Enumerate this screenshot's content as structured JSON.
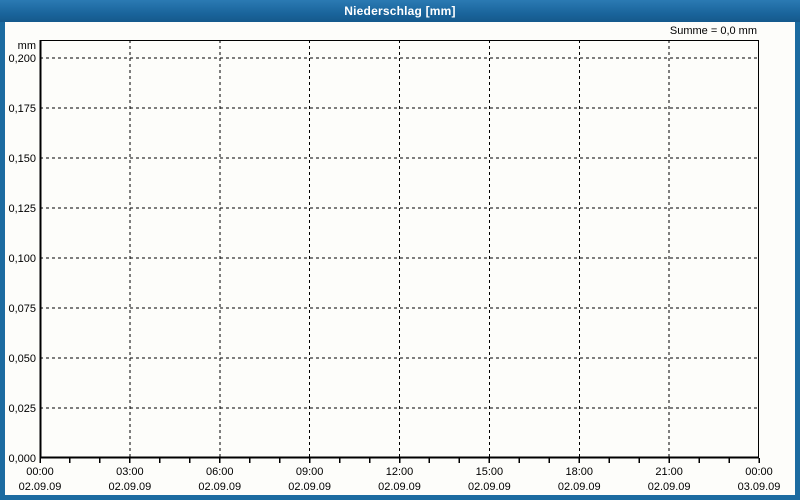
{
  "header": {
    "title": "Niederschlag [mm]"
  },
  "colors": {
    "frame_blue": "#1c6ba0",
    "header_gradient_top": "#2b7ab3",
    "header_gradient_bottom": "#15598c",
    "grid_line": "#000000",
    "axis_line": "#000000",
    "label_text": "#000000",
    "background": "#fdfdfa"
  },
  "chart_data": {
    "type": "line",
    "title": "Niederschlag [mm]",
    "unit_label": "mm",
    "annotation": "Summe = 0,0 mm",
    "sum_value_mm": 0.0,
    "ylabel": "mm",
    "ylim": [
      0.0,
      0.2
    ],
    "y_tick_step": 0.025,
    "y_tick_labels": [
      "0,200",
      "0,175",
      "0,150",
      "0,125",
      "0,100",
      "0,075",
      "0,050",
      "0,025",
      "0,000"
    ],
    "x_range_hours": [
      0,
      24
    ],
    "x_minor_tick_hours": 1,
    "x_major_ticks": [
      {
        "hour": 0,
        "time": "00:00",
        "date": "02.09.09"
      },
      {
        "hour": 3,
        "time": "03:00",
        "date": "02.09.09"
      },
      {
        "hour": 6,
        "time": "06:00",
        "date": "02.09.09"
      },
      {
        "hour": 9,
        "time": "09:00",
        "date": "02.09.09"
      },
      {
        "hour": 12,
        "time": "12:00",
        "date": "02.09.09"
      },
      {
        "hour": 15,
        "time": "15:00",
        "date": "02.09.09"
      },
      {
        "hour": 18,
        "time": "18:00",
        "date": "02.09.09"
      },
      {
        "hour": 21,
        "time": "21:00",
        "date": "02.09.09"
      },
      {
        "hour": 24,
        "time": "00:00",
        "date": "03.09.09"
      }
    ],
    "grid": true,
    "grid_style": "dashed",
    "legend": "none",
    "series": [
      {
        "name": "Niederschlag",
        "values": [],
        "note_visible_on_screen": "Summe = 0,0 mm"
      }
    ]
  }
}
